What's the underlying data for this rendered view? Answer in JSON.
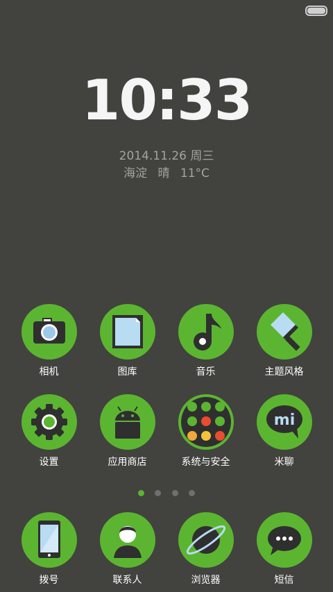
{
  "status": {
    "battery_icon": "battery-full-icon"
  },
  "lockscreen": {
    "time": "10:33",
    "date": "2014.11.26 周三",
    "weather_location": "海淀",
    "weather_condition": "晴",
    "weather_temp": "11°C"
  },
  "apps_row1": [
    {
      "label": "相机",
      "icon": "camera-icon"
    },
    {
      "label": "图库",
      "icon": "gallery-icon"
    },
    {
      "label": "音乐",
      "icon": "music-icon"
    },
    {
      "label": "主题风格",
      "icon": "theme-brush-icon"
    }
  ],
  "apps_row2": [
    {
      "label": "设置",
      "icon": "gear-icon"
    },
    {
      "label": "应用商店",
      "icon": "android-store-icon"
    },
    {
      "label": "系统与安全",
      "icon": "folder-icon"
    },
    {
      "label": "米聊",
      "icon": "mi-chat-icon",
      "icon_text": "mi"
    }
  ],
  "page_indicator": {
    "pages": 4,
    "active_page": 1
  },
  "dock": [
    {
      "label": "拨号",
      "icon": "phone-icon"
    },
    {
      "label": "联系人",
      "icon": "contacts-icon"
    },
    {
      "label": "浏览器",
      "icon": "browser-icon"
    },
    {
      "label": "短信",
      "icon": "message-icon"
    }
  ],
  "colors": {
    "background": "#42423f",
    "accent": "#5cb531",
    "text_secondary": "#a3a39f"
  }
}
